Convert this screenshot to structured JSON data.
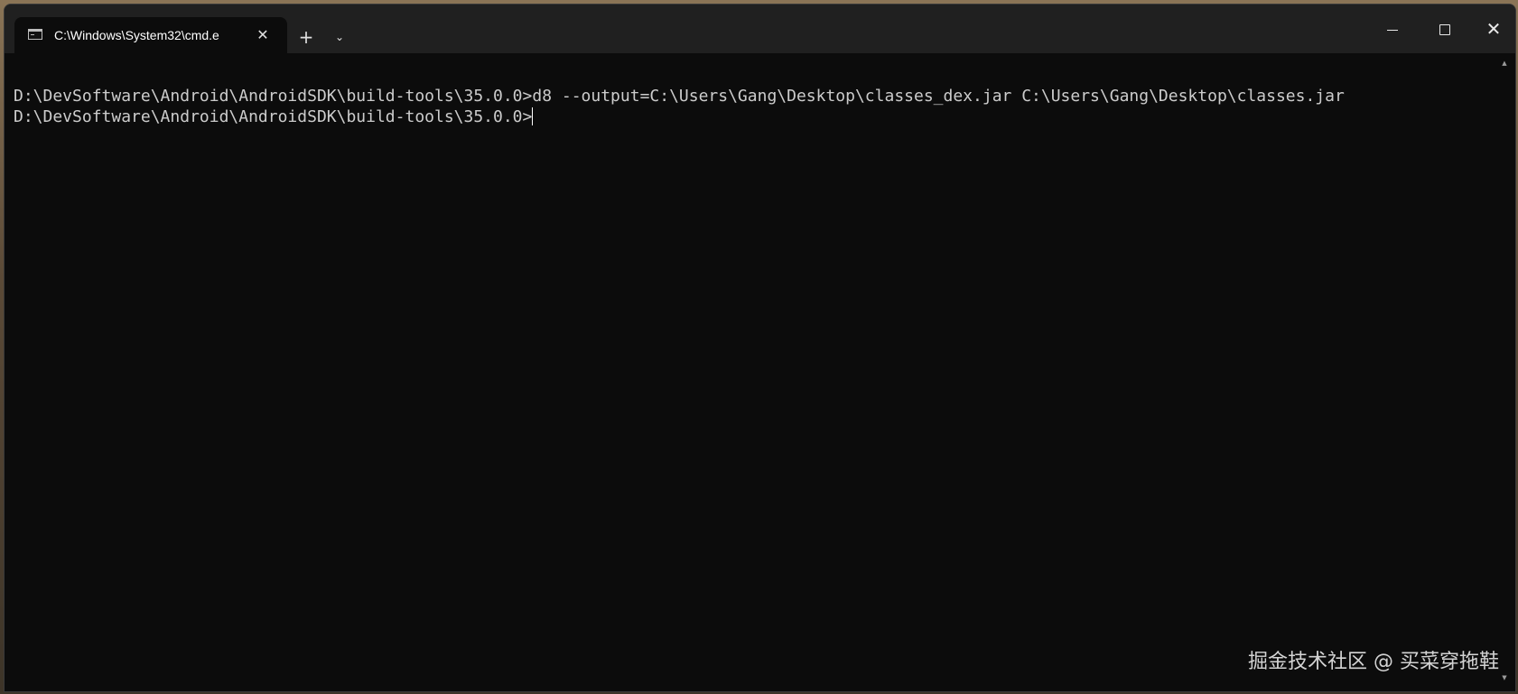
{
  "window": {
    "tab_title": "C:\\Windows\\System32\\cmd.e",
    "tab_close_glyph": "✕",
    "new_tab_glyph": "+",
    "tab_dropdown_glyph": "⌄",
    "close_glyph": "✕",
    "icons": {
      "tab": "cmd-icon",
      "tab_close": "close-icon",
      "new_tab": "plus-icon",
      "dropdown": "chevron-down-icon",
      "minimize": "minimize-icon",
      "maximize": "maximize-icon",
      "close": "close-icon"
    }
  },
  "terminal": {
    "lines": [
      "D:\\DevSoftware\\Android\\AndroidSDK\\build-tools\\35.0.0>d8 --output=C:\\Users\\Gang\\Desktop\\classes_dex.jar C:\\Users\\Gang\\Desktop\\classes.jar",
      "D:\\DevSoftware\\Android\\AndroidSDK\\build-tools\\35.0.0>"
    ],
    "background": "#0c0c0c",
    "foreground": "#cccccc"
  },
  "scrollbar": {
    "up_glyph": "▲",
    "down_glyph": "▼"
  },
  "watermark": {
    "text": "掘金技术社区 @ 买菜穿拖鞋"
  }
}
